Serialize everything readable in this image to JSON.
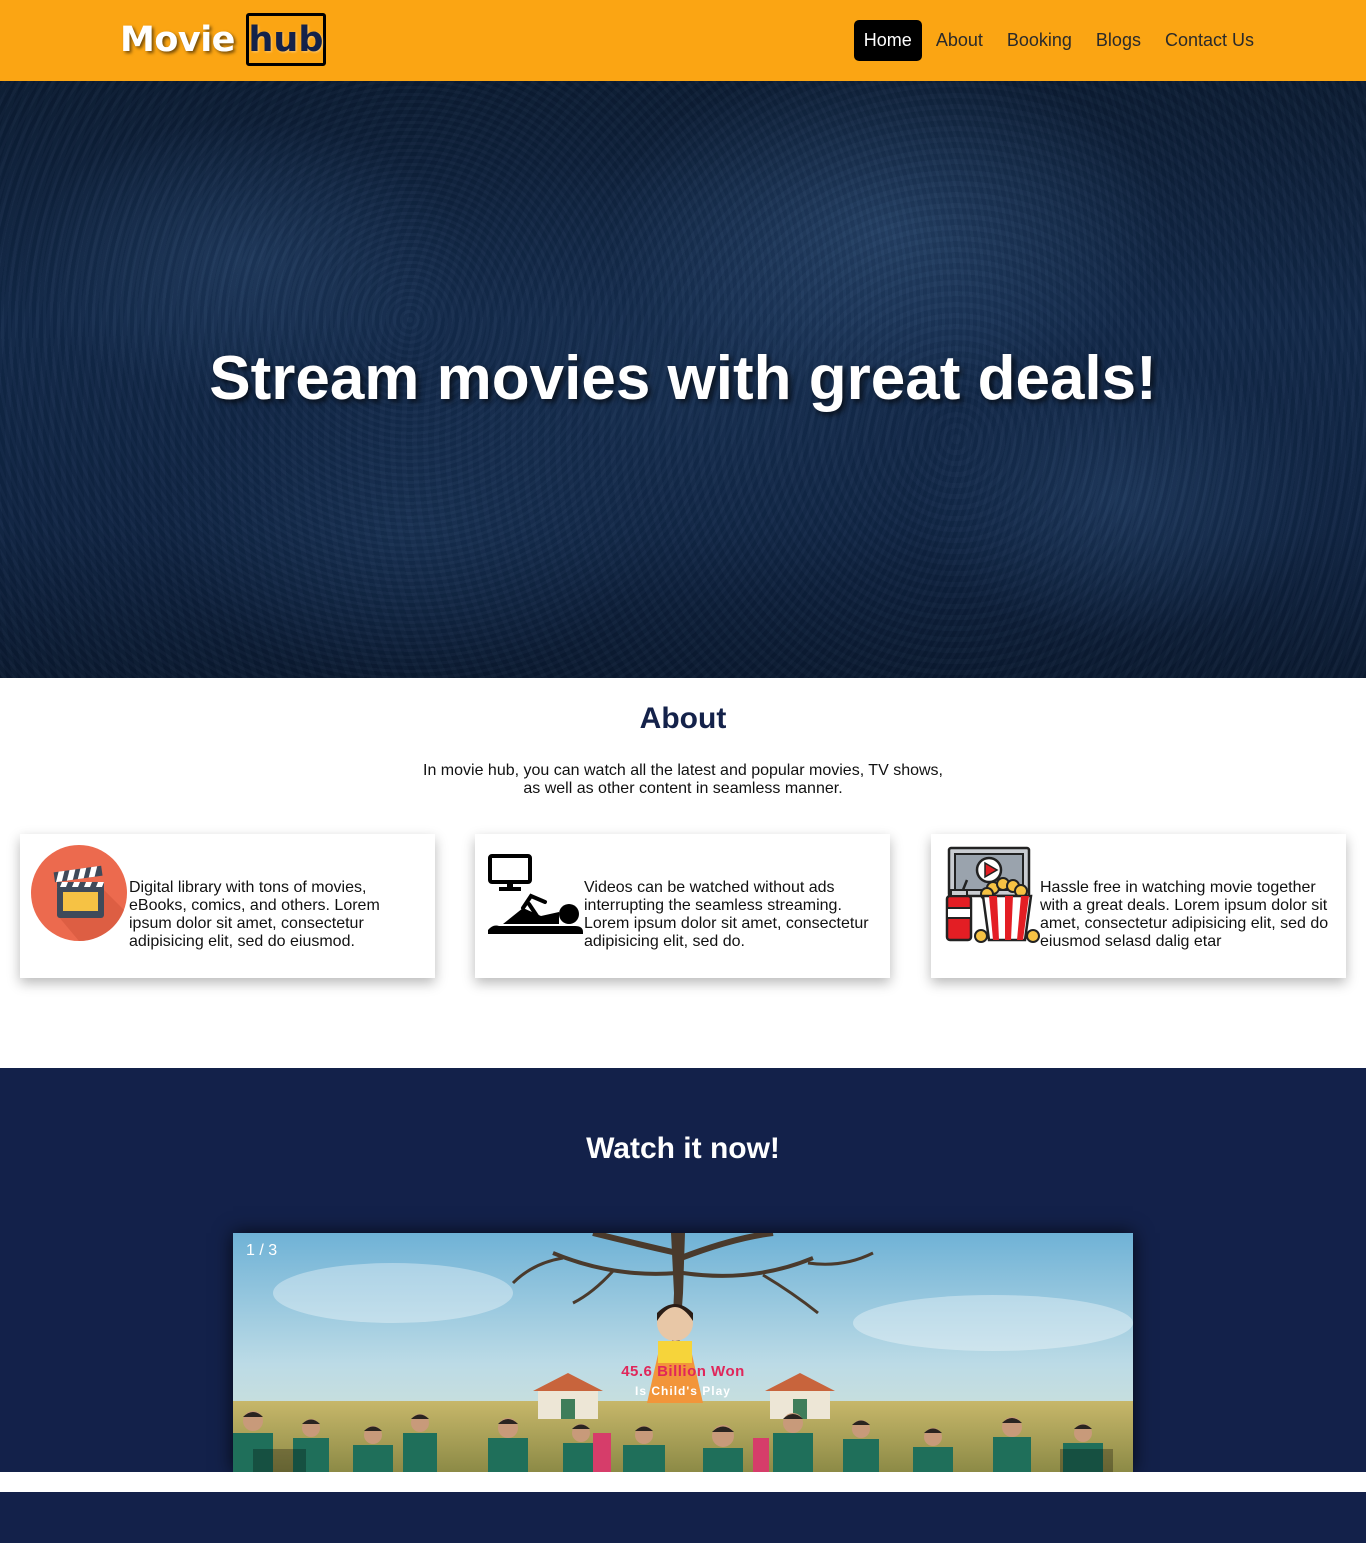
{
  "brand": {
    "name_part1": "Movie",
    "name_part2": "hub",
    "primary_color": "#fba513",
    "dark_color": "#13214a"
  },
  "nav": {
    "items": [
      {
        "label": "Home",
        "active": true
      },
      {
        "label": "About",
        "active": false
      },
      {
        "label": "Booking",
        "active": false
      },
      {
        "label": "Blogs",
        "active": false
      },
      {
        "label": "Contact Us",
        "active": false
      }
    ]
  },
  "hero": {
    "title": "Stream movies with great deals!"
  },
  "about": {
    "title": "About",
    "description": "In movie hub, you can watch all the latest and popular movies, TV shows, as well as other content in seamless manner.",
    "cards": [
      {
        "icon": "clapperboard-icon",
        "text": "Digital library with tons of movies, eBooks, comics, and others. Lorem ipsum dolor sit amet, consectetur adipisicing elit, sed do eiusmod."
      },
      {
        "icon": "tv-watching-icon",
        "text": "Videos can be watched without ads interrupting the seamless streaming. Lorem ipsum dolor sit amet, consectetur adipisicing elit, sed do."
      },
      {
        "icon": "cinema-popcorn-icon",
        "text": "Hassle free in watching movie together with a great deals. Lorem ipsum dolor sit amet, consectetur adipisicing elit, sed do eiusmod selasd dalig etar"
      }
    ]
  },
  "watch": {
    "title": "Watch it now!",
    "slider": {
      "counter": "1 / 3",
      "current": 1,
      "total": 3,
      "headline": "45.6 Billion Won",
      "subheadline": "Is Child's Play"
    }
  }
}
